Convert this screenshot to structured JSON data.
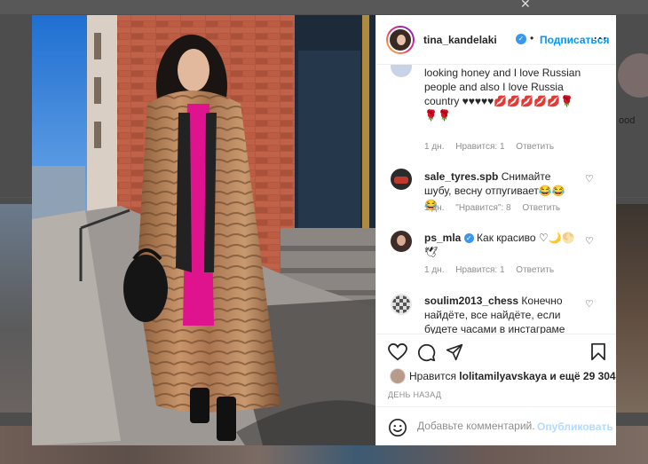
{
  "background": {
    "story_label": "ood",
    "close_glyph": "✕"
  },
  "post": {
    "username": "tina_kandelaki",
    "verified_mark": "✓",
    "separator": "•",
    "follow_label": "Подписаться",
    "more_glyph": "⋯"
  },
  "comments": [
    {
      "username": "",
      "text": "looking honey and I love Russian people and also I love Russia country ♥♥♥♥♥💋💋💋💋💋🌹🌹🌹",
      "time": "1 дн.",
      "likes": "Нравится: 1",
      "reply": "Ответить"
    },
    {
      "username": "sale_tyres.spb",
      "text": "Снимайте шубу, весну отпугивает😂😂😂",
      "time": "1 дн.",
      "likes": "\"Нравится\": 8",
      "reply": "Ответить"
    },
    {
      "username": "ps_mla",
      "text": "Как красиво ♡🌙🌕🕊",
      "time": "1 дн.",
      "likes": "Нравится: 1",
      "reply": "Ответить"
    },
    {
      "username": "soulim2013_chess",
      "text": "Конечно найдёте, все найдёте, если будете часами в инстаграме сидеть👏🤦‍♂️👍",
      "time": "",
      "likes": "",
      "reply": ""
    }
  ],
  "actions": {
    "likes_prefix": "Нравится",
    "likes_user": "lolitamilyavskaya",
    "likes_suffix": "и ещё 29 304",
    "time_ago": "День назад",
    "comment_placeholder": "Добавьте комментарий...",
    "post_label": "Опубликовать"
  },
  "icons": [
    "heart-icon",
    "comment-icon",
    "share-icon",
    "bookmark-icon",
    "emoji-icon",
    "like-comment-icon"
  ],
  "colors": {
    "link": "#0095f6",
    "post_disabled": "#b3dbff",
    "verified": "#3897f0",
    "text": "#262626",
    "muted": "#8e8e8e"
  }
}
